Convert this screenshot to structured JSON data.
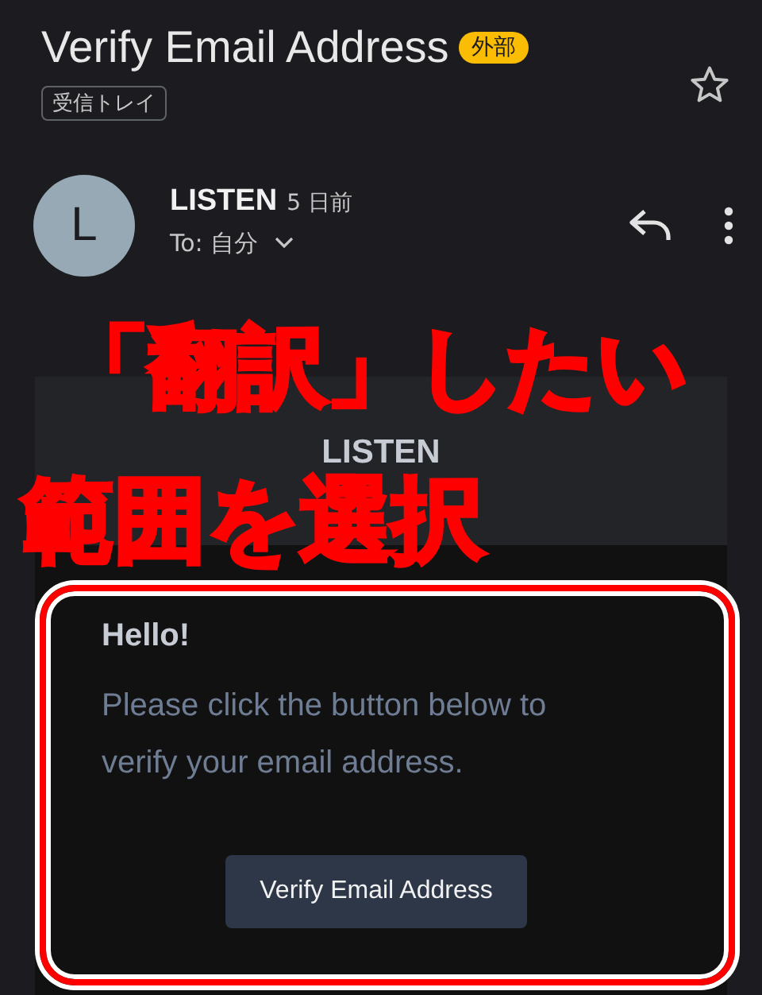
{
  "header": {
    "subject": "Verify Email Address",
    "badge": "外部",
    "label": "受信トレイ",
    "starred": false
  },
  "sender": {
    "avatar_letter": "L",
    "name": "LISTEN",
    "time": "5 日前",
    "recipient": "To: 自分"
  },
  "email": {
    "banner": "LISTEN",
    "greeting": "Hello!",
    "body": "Please click the button below to verify your email address.",
    "button": "Verify Email Address"
  },
  "annotation": {
    "caption_lines": [
      "「翻訳」したい",
      "範囲を選択"
    ]
  }
}
